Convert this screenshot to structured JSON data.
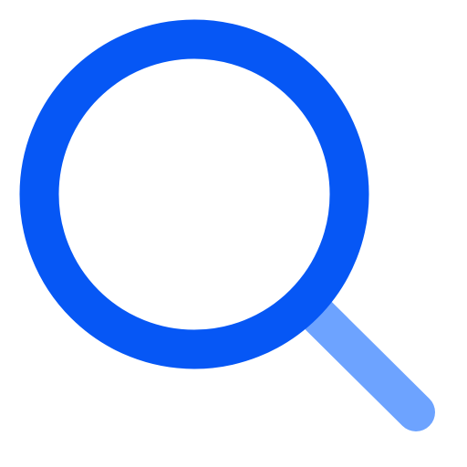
{
  "icon": {
    "name": "search-icon",
    "lens_color": "#0657F5",
    "handle_color": "#6DA3FF",
    "background_color": "#FFFFFF"
  }
}
